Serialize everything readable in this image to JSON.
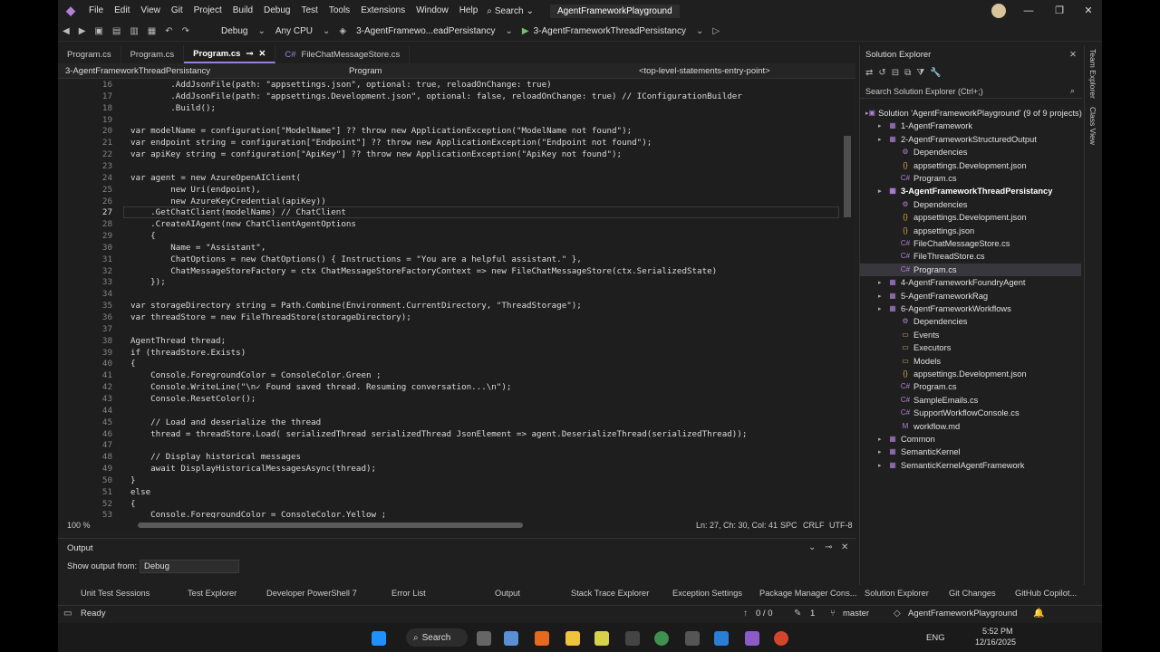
{
  "colors": {
    "accent": "#9d7fdc",
    "background": "#1f1f1f",
    "editor_bg": "#1e1e1e"
  },
  "menu": [
    "File",
    "Edit",
    "View",
    "Git",
    "Project",
    "Build",
    "Debug",
    "Test",
    "Tools",
    "Extensions",
    "Window",
    "Help"
  ],
  "search_label": "Search",
  "app_title": "AgentFrameworkPlayground",
  "toolbar": {
    "config": "Debug",
    "platform": "Any CPU",
    "startup_project": "3-AgentFramewo...eadPersistancy",
    "run_target": "3-AgentFrameworkThreadPersistancy"
  },
  "tabs": [
    {
      "label": "Program.cs",
      "active": false
    },
    {
      "label": "Program.cs",
      "active": false
    },
    {
      "label": "Program.cs",
      "active": true
    },
    {
      "label": "FileChatMessageStore.cs",
      "active": false
    }
  ],
  "navbar": {
    "project": "3-AgentFrameworkThreadPersistancy",
    "type": "Program",
    "member": "<top-level-statements-entry-point>"
  },
  "editor": {
    "lines": [
      {
        "n": "16",
        "t": "        .AddJsonFile(path: \"appsettings.json\", optional: true, reloadOnChange: true)"
      },
      {
        "n": "17",
        "t": "        .AddJsonFile(path: \"appsettings.Development.json\", optional: false, reloadOnChange: true) // IConfigurationBuilder"
      },
      {
        "n": "18",
        "t": "        .Build();"
      },
      {
        "n": "19",
        "t": ""
      },
      {
        "n": "20",
        "t": "var modelName = configuration[\"ModelName\"] ?? throw new ApplicationException(\"ModelName not found\");"
      },
      {
        "n": "21",
        "t": "var endpoint string = configuration[\"Endpoint\"] ?? throw new ApplicationException(\"Endpoint not found\");"
      },
      {
        "n": "22",
        "t": "var apiKey string = configuration[\"ApiKey\"] ?? throw new ApplicationException(\"ApiKey not found\");"
      },
      {
        "n": "23",
        "t": ""
      },
      {
        "n": "24",
        "t": "var agent = new AzureOpenAIClient("
      },
      {
        "n": "25",
        "t": "        new Uri(endpoint),"
      },
      {
        "n": "26",
        "t": "        new AzureKeyCredential(apiKey))"
      },
      {
        "n": "27",
        "t": "    .GetChatClient(modelName) // ChatClient"
      },
      {
        "n": "28",
        "t": "    .CreateAIAgent(new ChatClientAgentOptions"
      },
      {
        "n": "29",
        "t": "    {"
      },
      {
        "n": "30",
        "t": "        Name = \"Assistant\","
      },
      {
        "n": "31",
        "t": "        ChatOptions = new ChatOptions() { Instructions = \"You are a helpful assistant.\" },"
      },
      {
        "n": "32",
        "t": "        ChatMessageStoreFactory = ctx ChatMessageStoreFactoryContext => new FileChatMessageStore(ctx.SerializedState)"
      },
      {
        "n": "33",
        "t": "    });"
      },
      {
        "n": "34",
        "t": ""
      },
      {
        "n": "35",
        "t": "var storageDirectory string = Path.Combine(Environment.CurrentDirectory, \"ThreadStorage\");"
      },
      {
        "n": "36",
        "t": "var threadStore = new FileThreadStore(storageDirectory);"
      },
      {
        "n": "37",
        "t": ""
      },
      {
        "n": "38",
        "t": "AgentThread thread;"
      },
      {
        "n": "39",
        "t": "if (threadStore.Exists)"
      },
      {
        "n": "40",
        "t": "{"
      },
      {
        "n": "41",
        "t": "    Console.ForegroundColor = ConsoleColor.Green ;"
      },
      {
        "n": "42",
        "t": "    Console.WriteLine(\"\\n✓ Found saved thread. Resuming conversation...\\n\");"
      },
      {
        "n": "43",
        "t": "    Console.ResetColor();"
      },
      {
        "n": "44",
        "t": ""
      },
      {
        "n": "45",
        "t": "    // Load and deserialize the thread"
      },
      {
        "n": "46",
        "t": "    thread = threadStore.Load( serializedThread serializedThread JsonElement => agent.DeserializeThread(serializedThread));"
      },
      {
        "n": "47",
        "t": ""
      },
      {
        "n": "48",
        "t": "    // Display historical messages"
      },
      {
        "n": "49",
        "t": "    await DisplayHistoricalMessagesAsync(thread);"
      },
      {
        "n": "50",
        "t": "}"
      },
      {
        "n": "51",
        "t": "else"
      },
      {
        "n": "52",
        "t": "{"
      },
      {
        "n": "53",
        "t": "    Console.ForegroundColor = ConsoleColor.Yellow ;"
      }
    ],
    "current_line": "27",
    "zoom": "100 %",
    "position": "Ln: 27, Ch: 30, Col: 41",
    "spc": "SPC",
    "eol": "CRLF",
    "enc": "UTF-8"
  },
  "solution_explorer": {
    "title": "Solution Explorer",
    "search_placeholder": "Search Solution Explorer (Ctrl+;)",
    "nodes": [
      {
        "label": "Solution 'AgentFrameworkPlayground' (9 of 9 projects)",
        "depth": 0,
        "icon": "solution-icon"
      },
      {
        "label": "1-AgentFramework",
        "depth": 1,
        "icon": "project-icon"
      },
      {
        "label": "2-AgentFrameworkStructuredOutput",
        "depth": 1,
        "icon": "project-icon"
      },
      {
        "label": "Dependencies",
        "depth": 2,
        "icon": "dependencies-icon"
      },
      {
        "label": "appsettings.Development.json",
        "depth": 2,
        "icon": "json-icon"
      },
      {
        "label": "Program.cs",
        "depth": 2,
        "icon": "csharp-icon"
      },
      {
        "label": "3-AgentFrameworkThreadPersistancy",
        "depth": 1,
        "icon": "project-icon",
        "bold": true
      },
      {
        "label": "Dependencies",
        "depth": 2,
        "icon": "dependencies-icon"
      },
      {
        "label": "appsettings.Development.json",
        "depth": 2,
        "icon": "json-icon"
      },
      {
        "label": "appsettings.json",
        "depth": 2,
        "icon": "json-icon"
      },
      {
        "label": "FileChatMessageStore.cs",
        "depth": 2,
        "icon": "csharp-icon"
      },
      {
        "label": "FileThreadStore.cs",
        "depth": 2,
        "icon": "csharp-icon"
      },
      {
        "label": "Program.cs",
        "depth": 2,
        "icon": "csharp-icon",
        "selected": true
      },
      {
        "label": "4-AgentFrameworkFoundryAgent",
        "depth": 1,
        "icon": "project-icon"
      },
      {
        "label": "5-AgentFrameworkRag",
        "depth": 1,
        "icon": "project-icon"
      },
      {
        "label": "6-AgentFrameworkWorkflows",
        "depth": 1,
        "icon": "project-icon"
      },
      {
        "label": "Dependencies",
        "depth": 2,
        "icon": "dependencies-icon"
      },
      {
        "label": "Events",
        "depth": 2,
        "icon": "folder-icon"
      },
      {
        "label": "Executors",
        "depth": 2,
        "icon": "folder-icon"
      },
      {
        "label": "Models",
        "depth": 2,
        "icon": "folder-icon"
      },
      {
        "label": "appsettings.Development.json",
        "depth": 2,
        "icon": "json-icon"
      },
      {
        "label": "Program.cs",
        "depth": 2,
        "icon": "csharp-icon"
      },
      {
        "label": "SampleEmails.cs",
        "depth": 2,
        "icon": "csharp-icon"
      },
      {
        "label": "SupportWorkflowConsole.cs",
        "depth": 2,
        "icon": "csharp-icon"
      },
      {
        "label": "workflow.md",
        "depth": 2,
        "icon": "markdown-icon"
      },
      {
        "label": "Common",
        "depth": 1,
        "icon": "project-icon"
      },
      {
        "label": "SemanticKernel",
        "depth": 1,
        "icon": "project-icon"
      },
      {
        "label": "SemanticKernelAgentFramework",
        "depth": 1,
        "icon": "project-icon"
      }
    ]
  },
  "right_tabs": [
    "Team Explorer",
    "Class View"
  ],
  "output": {
    "title": "Output",
    "show_from_label": "Show output from:",
    "source": "Debug"
  },
  "bottom_tabs": [
    "Unit Test Sessions",
    "Test Explorer",
    "Developer PowerShell 7",
    "Error List",
    "Output",
    "Stack Trace Explorer",
    "Exception Settings",
    "Package Manager Cons..."
  ],
  "se_bottom_tabs": [
    "Solution Explorer",
    "Git Changes",
    "GitHub Copilot..."
  ],
  "status": {
    "ready": "Ready",
    "errors": "0 / 0",
    "warnings": "1",
    "branch": "master",
    "repo": "AgentFrameworkPlayground"
  },
  "taskbar": {
    "search": "Search",
    "lang": "ENG",
    "time": "5:52 PM",
    "date": "12/16/2025"
  }
}
